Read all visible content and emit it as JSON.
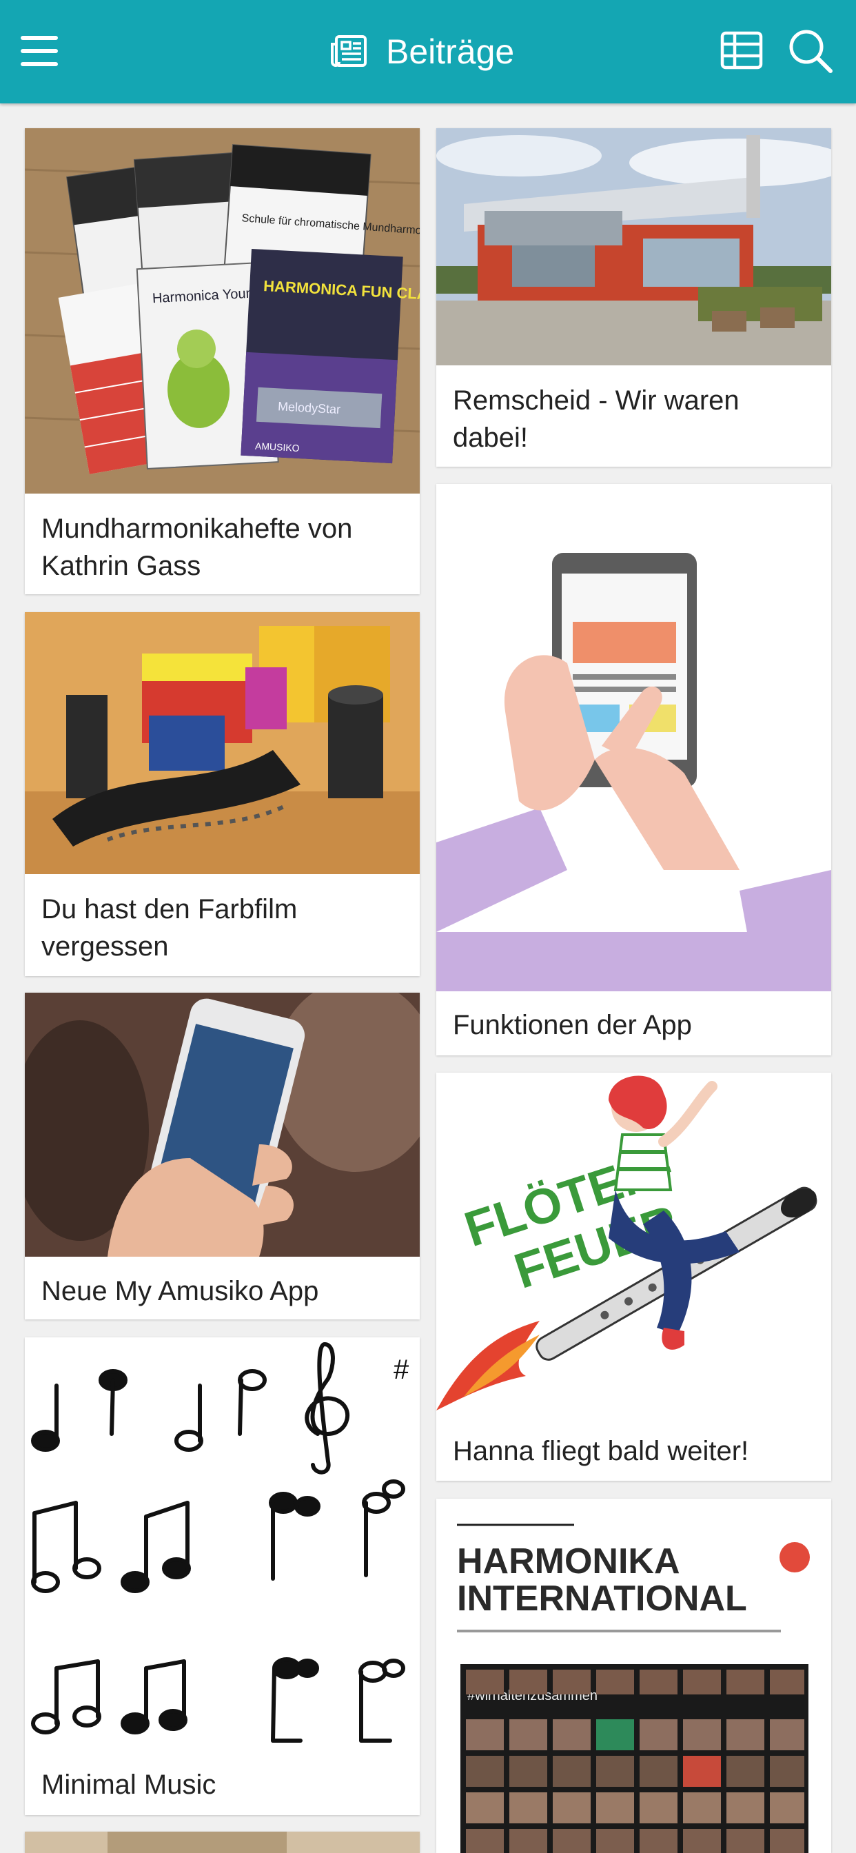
{
  "header": {
    "title": "Beiträge",
    "menu_icon": "hamburger-menu-icon",
    "title_icon": "newspaper-icon",
    "grid_icon": "table-view-icon",
    "search_icon": "search-icon",
    "bar_color": "#14a6b3"
  },
  "posts": [
    {
      "title": "Mundharmonikahefte von Kathrin Gass",
      "image": "harmonica-books-photo"
    },
    {
      "title": "Remscheid - Wir waren dabei!",
      "image": "building-photo"
    },
    {
      "title": "Du hast den Farbfilm vergessen",
      "image": "film-rolls-photo"
    },
    {
      "title": "Funktionen der App",
      "image": "phone-in-hands-illustration"
    },
    {
      "title": "Neue My Amusiko App",
      "image": "smartphone-in-hand-photo"
    },
    {
      "title": "Hanna fliegt bald weiter!",
      "image": "floeten-feuer-illustration"
    },
    {
      "title": "Minimal Music",
      "image": "music-notes-drawing"
    },
    {
      "title": "",
      "image": "harmonika-international-cover"
    }
  ],
  "images_text": {
    "books": [
      "Schule für chromatische Mundharmonika",
      "HARMONICA FUN CLASS",
      "Harmonica Young",
      "MelodyStar",
      "AMUSIKO"
    ],
    "floeten": [
      "FLÖTEN-",
      "FEUER"
    ],
    "magazine": [
      "HARMONIKA",
      "INTERNATIONAL",
      "#wirhaltenzusammen"
    ]
  }
}
